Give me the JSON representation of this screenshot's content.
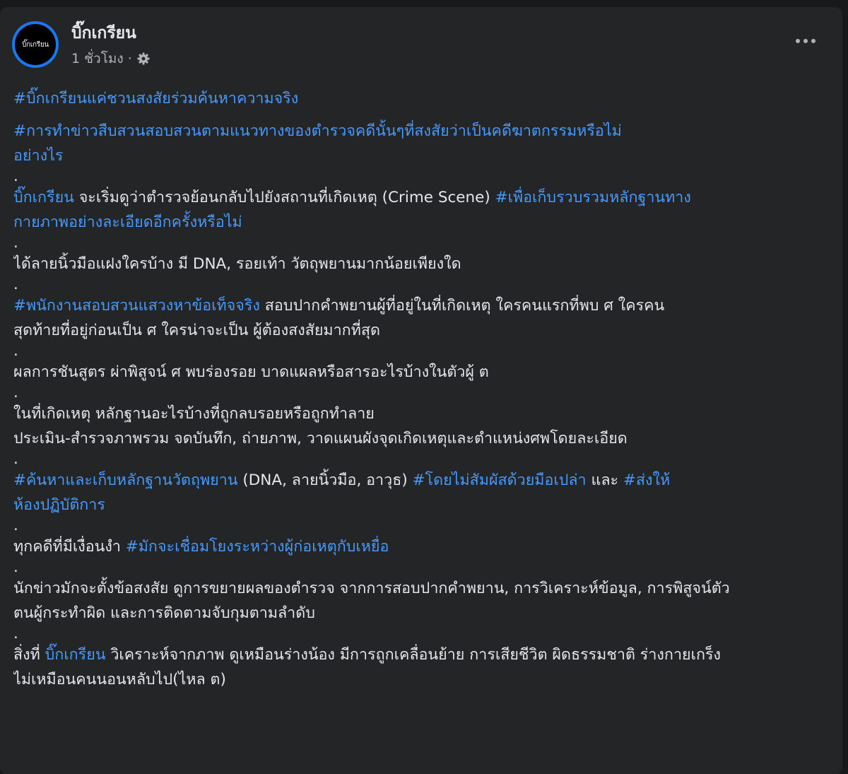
{
  "post": {
    "author": "บิ๊กเกรียน",
    "avatar_text": "บิ๊กเกรียน",
    "time": "1 ชั่วโมง",
    "separator": "·",
    "privacy_icon": "gear-icon",
    "more_icon": "more-options-icon"
  },
  "body": {
    "p1": {
      "tag": "#บิ๊กเกรียนแค่ชวนสงสัยร่วมค้นหาความจริง"
    },
    "p2": {
      "tag_line1": "#การทำข่าวสืบสวนสอบสวนตามแนวทางของตำรวจคดีนั้นๆที่สงสัยว่าเป็นคดีฆาตกรรมหรือไม่",
      "tag_line2": "อย่างไร"
    },
    "p3": {
      "mention": "บิ๊กเกรียน",
      "text": " จะเริ่มดูว่าตำรวจย้อนกลับไปยังสถานที่เกิดเหตุ (Crime Scene) ",
      "tag_line1": "#เพื่อเก็บรวบรวมหลักฐานทาง",
      "tag_line2": "กายภาพอย่างละเอียดอีกครั้งหรือไม่"
    },
    "p4": {
      "text": "ได้ลายนิ้วมือแฝงใครบ้าง มี DNA, รอยเท้า วัตถุพยานมากน้อยเพียงใด"
    },
    "p5": {
      "tag": "#พนักงานสอบสวนแสวงหาข้อเท็จจริง",
      "text_line1": " สอบปากคำพยานผู้ที่อยู่ในที่เกิดเหตุ ใครคนแรกที่พบ ศ ใครคน",
      "text_line2": "สุดท้ายที่อยู่ก่อนเป็น ศ ใครน่าจะเป็น ผู้ต้องสงสัยมากที่สุด"
    },
    "p6": {
      "text": "ผลการชันสูตร ผ่าพิสูจน์ ศ พบร่องรอย บาดแผลหรือสารอะไรบ้างในตัวผู้ ต"
    },
    "p7": {
      "text_line1": "ในที่เกิดเหตุ หลักฐานอะไรบ้างที่ถูกลบรอยหรือถูกทำลาย",
      "text_line2": "ประเมิน-สำรวจภาพรวม จดบันทึก, ถ่ายภาพ, วาดแผนผังจุดเกิดเหตุและตำแหน่งศพโดยละเอียด"
    },
    "p8": {
      "tag1": "#ค้นหาและเก็บหลักฐานวัตถุพยาน",
      "text1": " (DNA, ลายนิ้วมือ, อาวุธ) ",
      "tag2": "#โดยไม่สัมผัสด้วยมือเปล่า",
      "text2": " และ ",
      "tag3_line1": "#ส่งให้",
      "tag3_line2": "ห้องปฏิบัติการ"
    },
    "p9": {
      "text": "ทุกคดีที่มีเงื่อนงำ ",
      "tag": "#มักจะเชื่อมโยงระหว่างผู้ก่อเหตุกับเหยื่อ"
    },
    "p10": {
      "text_line1": "นักข่าวมักจะตั้งข้อสงสัย ดูการขยายผลของตำรวจ จากการสอบปากคำพยาน, การวิเคราะห์ข้อมูล, การพิสูจน์ตัว",
      "text_line2": "ตนผู้กระทำผิด และการติดตามจับกุมตามลำดับ"
    },
    "p11": {
      "text1": "สิ่งที่ ",
      "mention": "บิ๊กเกรียน",
      "text2": " วิเคราะห์จากภาพ ดูเหมือนร่างน้อง มีการถูกเคลื่อนย้าย การเสียชีวิต ผิดธรรมชาติ ร่างกายเกร็ง",
      "text_line2": "ไม่เหมือนคนนอนหลับไป(ไหล ต)"
    },
    "dot": "."
  },
  "colors": {
    "background": "#18191a",
    "card": "#242526",
    "text": "#e4e6eb",
    "secondary_text": "#b0b3b8",
    "link": "#4599ff",
    "avatar_ring": "#1877f2"
  }
}
